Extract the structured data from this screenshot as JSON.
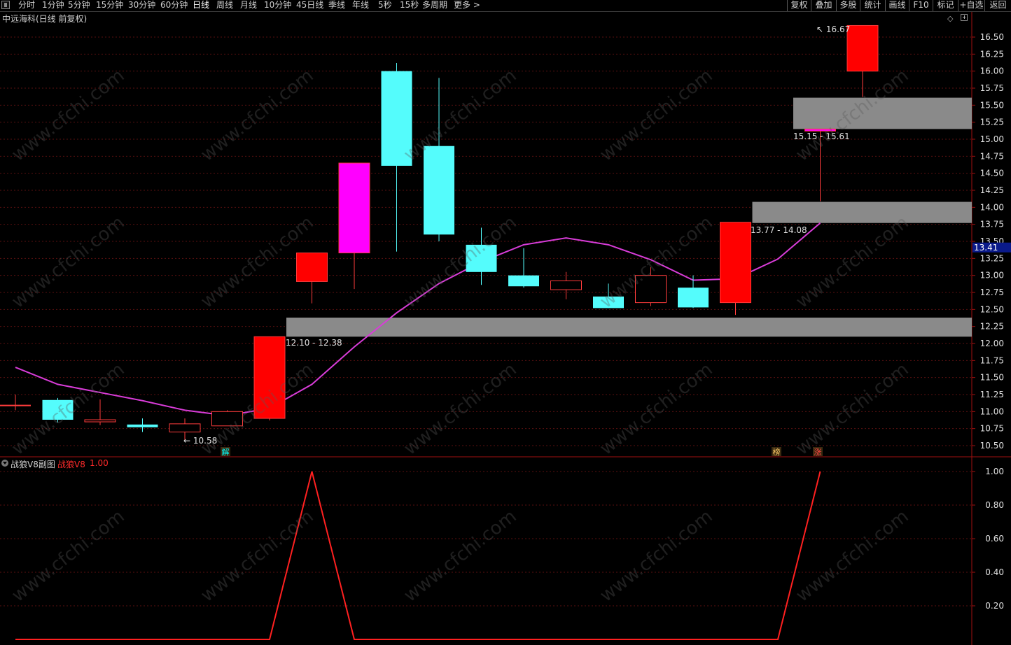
{
  "toolbar": {
    "periods": [
      "分时",
      "1分钟",
      "5分钟",
      "15分钟",
      "30分钟",
      "60分钟",
      "日线",
      "周线",
      "月线",
      "10分钟",
      "45日线",
      "季线",
      "年线",
      "5秒",
      "15秒",
      "多周期",
      "更多 >"
    ],
    "active_period": "日线",
    "right_buttons": [
      "复权",
      "叠加",
      "多股",
      "统计",
      "画线",
      "F10",
      "标记",
      "+自选",
      "返回"
    ]
  },
  "stock": {
    "title": "中远海科(日线 前复权)"
  },
  "main_chart": {
    "price_ticks": [
      "16.50",
      "16.25",
      "16.00",
      "15.75",
      "15.50",
      "15.25",
      "15.00",
      "14.75",
      "14.50",
      "14.25",
      "14.00",
      "13.75",
      "13.50",
      "13.25",
      "13.00",
      "12.75",
      "12.50",
      "12.25",
      "12.00",
      "11.75",
      "11.50",
      "11.25",
      "11.00",
      "10.75",
      "10.50"
    ],
    "current_price": "13.41",
    "high_label": "16.67",
    "low_label": "10.58",
    "zone_labels": [
      "12.10 - 12.38",
      "13.77 - 14.08",
      "15.15 - 15.61"
    ],
    "markers": [
      {
        "text": "解",
        "color": "#00ffff"
      },
      {
        "text": "榜",
        "color": "#ffcc66"
      },
      {
        "text": "涨",
        "color": "#ff4444"
      }
    ]
  },
  "chart_data": [
    {
      "type": "candlestick",
      "ylim": [
        10.45,
        16.8
      ],
      "candles": [
        {
          "o": 11.09,
          "h": 11.25,
          "l": 11.02,
          "c": 11.09,
          "kind": "flat"
        },
        {
          "o": 11.17,
          "h": 11.2,
          "l": 10.84,
          "c": 10.88,
          "kind": "down"
        },
        {
          "o": 10.86,
          "h": 11.18,
          "l": 10.8,
          "c": 10.88,
          "kind": "up-hollow"
        },
        {
          "o": 10.81,
          "h": 10.9,
          "l": 10.7,
          "c": 10.77,
          "kind": "down"
        },
        {
          "o": 10.7,
          "h": 10.9,
          "l": 10.58,
          "c": 10.82,
          "kind": "up-hollow"
        },
        {
          "o": 10.79,
          "h": 11.02,
          "l": 10.79,
          "c": 11.0,
          "kind": "up-hollow"
        },
        {
          "o": 10.9,
          "h": 12.1,
          "l": 10.87,
          "c": 12.1,
          "kind": "up"
        },
        {
          "o": 12.91,
          "h": 13.33,
          "l": 12.59,
          "c": 13.33,
          "kind": "up"
        },
        {
          "o": 13.33,
          "h": 14.65,
          "l": 12.8,
          "c": 14.65,
          "kind": "special"
        },
        {
          "o": 16.0,
          "h": 16.12,
          "l": 13.35,
          "c": 14.61,
          "kind": "down"
        },
        {
          "o": 14.9,
          "h": 15.9,
          "l": 13.5,
          "c": 13.6,
          "kind": "down"
        },
        {
          "o": 13.45,
          "h": 13.7,
          "l": 12.86,
          "c": 13.05,
          "kind": "down"
        },
        {
          "o": 13.0,
          "h": 13.4,
          "l": 12.82,
          "c": 12.84,
          "kind": "down"
        },
        {
          "o": 12.79,
          "h": 13.05,
          "l": 12.65,
          "c": 12.92,
          "kind": "up-hollow"
        },
        {
          "o": 12.69,
          "h": 12.88,
          "l": 12.52,
          "c": 12.52,
          "kind": "down"
        },
        {
          "o": 12.6,
          "h": 13.12,
          "l": 12.55,
          "c": 13.0,
          "kind": "up-hollow"
        },
        {
          "o": 12.82,
          "h": 13.0,
          "l": 12.52,
          "c": 12.53,
          "kind": "down"
        },
        {
          "o": 12.6,
          "h": 13.78,
          "l": 12.42,
          "c": 13.78,
          "kind": "up"
        },
        {
          "o": 14.09,
          "h": 14.09,
          "l": 14.09,
          "c": 14.09,
          "kind": "none"
        },
        {
          "o": 15.15,
          "h": 15.15,
          "l": 14.09,
          "c": 15.15,
          "kind": "special-box"
        },
        {
          "o": 16.0,
          "h": 16.67,
          "l": 15.62,
          "c": 16.67,
          "kind": "up"
        }
      ],
      "ma_series": [
        {
          "name": "",
          "color": "#d83cd8",
          "values": [
            11.65,
            11.4,
            11.28,
            11.16,
            11.02,
            10.94,
            11.05,
            11.4,
            11.95,
            12.45,
            12.88,
            13.2,
            13.45,
            13.55,
            13.45,
            13.23,
            12.93,
            12.95,
            13.24,
            13.77
          ]
        }
      ],
      "zones": [
        {
          "from": 12.1,
          "to": 12.38,
          "start_index": 6
        },
        {
          "from": 13.77,
          "to": 14.08,
          "start_index": 17
        },
        {
          "from": 15.15,
          "to": 15.61,
          "start_index": 18
        }
      ]
    },
    {
      "type": "line",
      "title": "战狼V8副图",
      "series": [
        {
          "name": "战狼V8",
          "color": "#ff2020",
          "values": [
            0,
            0,
            0,
            0,
            0,
            0,
            0,
            1,
            0,
            0,
            0,
            0,
            0,
            0,
            0,
            0,
            0,
            0,
            0,
            1
          ]
        }
      ],
      "ylim": [
        0,
        1.05
      ],
      "y_ticks": [
        "1.00",
        "0.80",
        "0.60",
        "0.40",
        "0.20"
      ]
    }
  ],
  "sub_chart": {
    "title": "战狼V8副图",
    "series_name": "战狼V8",
    "series_value": "1.00"
  },
  "watermark": "www.cfchi.com"
}
